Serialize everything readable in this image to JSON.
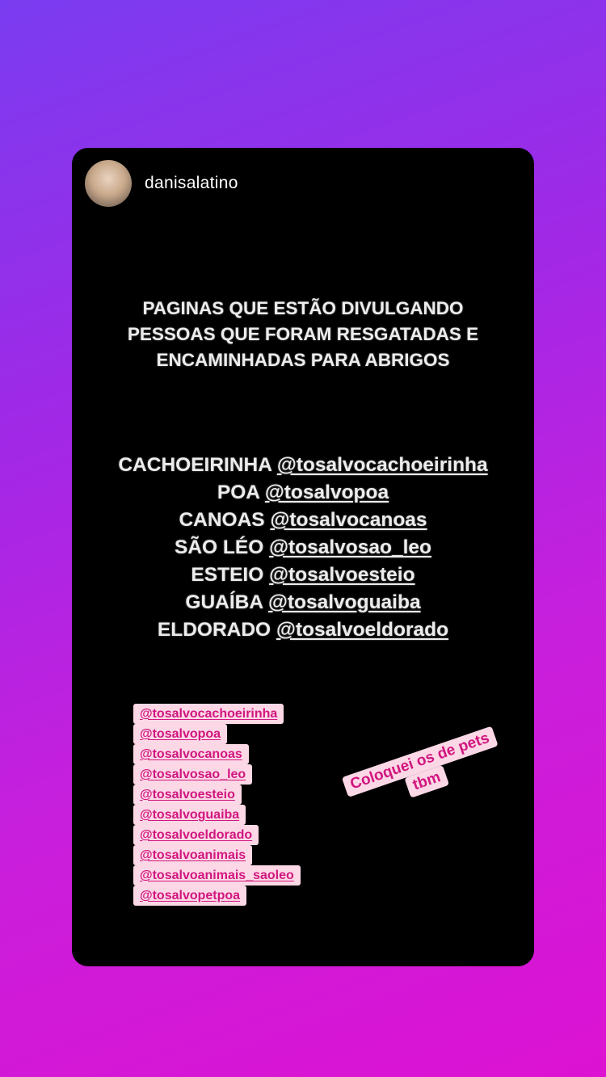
{
  "story": {
    "username": "danisalatino",
    "headline": [
      "PAGINAS QUE ESTÃO DIVULGANDO",
      "PESSOAS QUE FORAM RESGATADAS E",
      "ENCAMINHADAS PARA ABRIGOS"
    ],
    "cities": [
      {
        "name": "CACHOEIRINHA",
        "handle": "@tosalvocachoeirinha"
      },
      {
        "name": "POA",
        "handle": "@tosalvopoa"
      },
      {
        "name": "CANOAS",
        "handle": "@tosalvocanoas"
      },
      {
        "name": "SÃO LÉO",
        "handle": "@tosalvosao_leo"
      },
      {
        "name": "ESTEIO",
        "handle": "@tosalvoesteio"
      },
      {
        "name": "GUAÍBA",
        "handle": "@tosalvoguaiba"
      },
      {
        "name": "ELDORADO",
        "handle": "@tosalvoeldorado"
      }
    ],
    "mention_stickers": [
      "@tosalvocachoeirinha",
      "@tosalvopoa",
      "@tosalvocanoas",
      "@tosalvosao_leo",
      "@tosalvoesteio",
      "@tosalvoguaiba",
      "@tosalvoeldorado",
      "@tosalvoanimais",
      "@tosalvoanimais_saoleo",
      "@tosalvopetpoa"
    ],
    "note": [
      "Coloquei os de pets",
      "tbm"
    ]
  },
  "colors": {
    "background_gradient": [
      "#7a3cf0",
      "#dd12d2"
    ],
    "card": "#000000",
    "sticker_bg": "#fcd8e6",
    "sticker_text": "#d1167f"
  }
}
